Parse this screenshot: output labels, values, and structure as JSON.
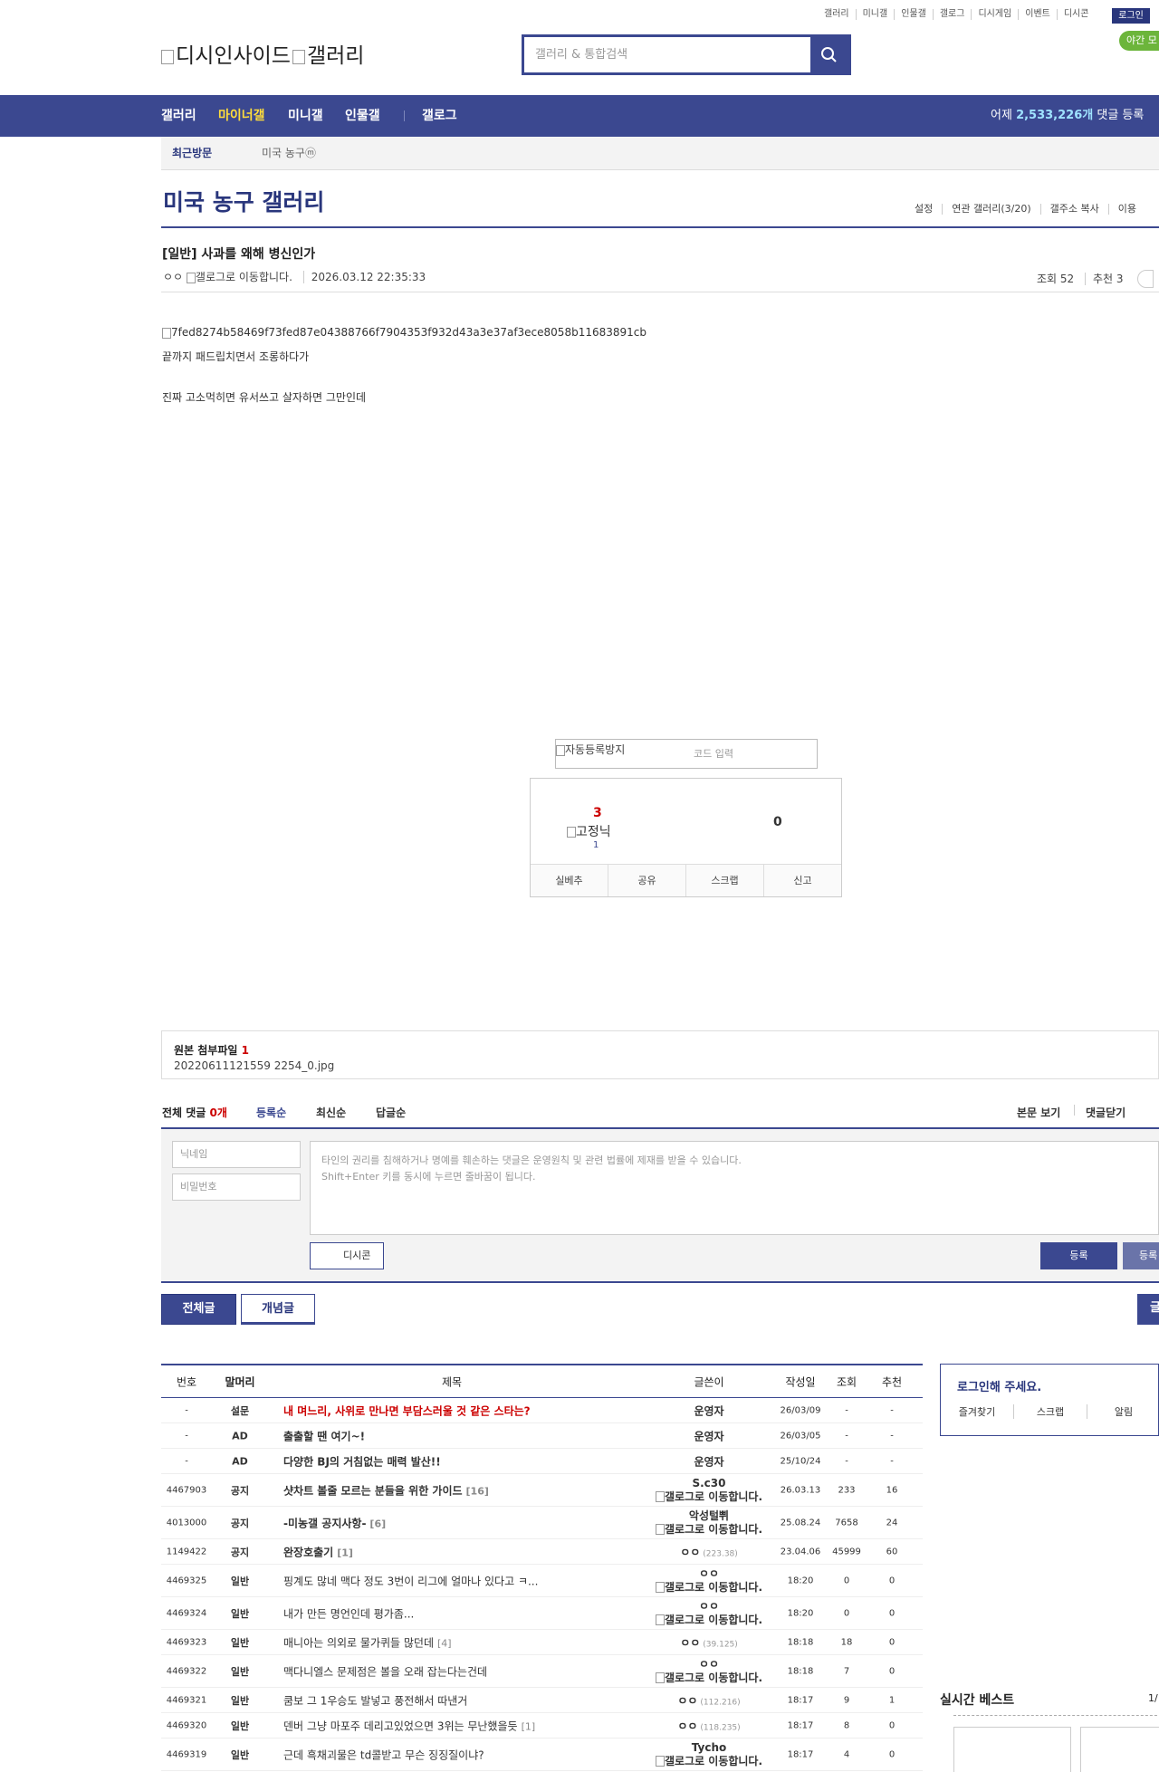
{
  "util_links": [
    "갤러리",
    "미니갤",
    "인물갤",
    "갤로그",
    "디시게임",
    "이벤트",
    "디시콘"
  ],
  "login_label": "로그인",
  "night_label": "야간 모",
  "logo_alt": "디시인사이드",
  "logo_alt2": "갤러리",
  "search_placeholder": "갤러리 & 통합검색",
  "nav": {
    "items": [
      "갤러리",
      "마이너갤",
      "미니갤",
      "인물갤",
      "갤로그"
    ],
    "yesterday_prefix": "어제",
    "yesterday_count": "2,533,226개",
    "yesterday_suffix": "댓글 등록"
  },
  "recent": {
    "label": "최근방문",
    "gallery": "미국 농구ⓜ"
  },
  "gallery_title": "미국 농구 갤러리",
  "gallery_opts": [
    "설정",
    "연관 갤러리(3/20)",
    "갤주소 복사",
    "이용"
  ],
  "post": {
    "title": "[일반] 사과를 왜해 병신인가",
    "author": "ㅇㅇ",
    "author_img_alt": "갤로그로 이동합니다.",
    "date": "2026.03.12 22:35:33",
    "views": "조회 52",
    "recommend": "추천 3",
    "image_alt": "7fed8274b58469f73fed87e04388766f7904353f932d43a3e37af3ece8058b11683891cb",
    "body_lines": [
      "끝까지 패드립치면서 조롱하다가",
      "진짜 고소먹히면 유서쓰고 살자하면 그만인데"
    ]
  },
  "captcha": {
    "img_alt": "자동등록방지",
    "placeholder": "코드 입력"
  },
  "vote": {
    "up": "3",
    "fix_alt": "고정닉",
    "fix_count": "1",
    "down": "0",
    "buttons": [
      "실베추",
      "공유",
      "스크랩",
      "신고"
    ]
  },
  "attach": {
    "label": "원본 첨부파일",
    "count": "1",
    "file": "20220611121559 2254_0.jpg"
  },
  "comments": {
    "all_label": "전체 댓글",
    "all_count": "0개",
    "sort": [
      "등록순",
      "최신순",
      "답글순"
    ],
    "right": [
      "본문 보기",
      "댓글닫기"
    ]
  },
  "comment_form": {
    "nick_ph": "닉네임",
    "pw_ph": "비밀번호",
    "ta_line1": "타인의 권리를 침해하거나 명예를 훼손하는 댓글은 운영원칙 및 관련 법률에 제재를 받을 수 있습니다.",
    "ta_line2": "Shift+Enter 키를 동시에 누르면 줄바꿈이 됩니다.",
    "dcon": "디시콘",
    "submit": "등록",
    "submit2": "등록"
  },
  "tabs": {
    "all": "전체글",
    "concept": "개념글",
    "write": "글"
  },
  "list_headers": [
    "번호",
    "말머리",
    "제목",
    "글쓴이",
    "작성일",
    "조회",
    "추천"
  ],
  "rows": [
    {
      "no": "-",
      "head": "설문",
      "title": "내 며느리, 사위로 만나면 부담스러울 것 같은 스타는?",
      "style": "red",
      "cnt": "",
      "writer": "운영자",
      "wline2": "",
      "ip": "",
      "date": "26/03/09",
      "views": "-",
      "rec": "-"
    },
    {
      "no": "-",
      "head": "AD",
      "title": "출출할 땐 여기~!",
      "style": "b",
      "cnt": "",
      "writer": "운영자",
      "wline2": "",
      "ip": "",
      "date": "26/03/05",
      "views": "-",
      "rec": "-"
    },
    {
      "no": "-",
      "head": "AD",
      "title": "다양한 BJ의 거침없는 매력 발산!!",
      "style": "b",
      "cnt": "",
      "writer": "운영자",
      "wline2": "",
      "ip": "",
      "date": "25/10/24",
      "views": "-",
      "rec": "-"
    },
    {
      "no": "4467903",
      "head": "공지",
      "title": "샷차트 볼줄 모르는 분들을 위한 가이드",
      "style": "b",
      "cnt": "[16]",
      "writer": "S.c30",
      "wline2": "갤로그로 이동합니다.",
      "ip": "",
      "date": "26.03.13",
      "views": "233",
      "rec": "16"
    },
    {
      "no": "4013000",
      "head": "공지",
      "title": "-미농갤 공지사항-",
      "style": "b",
      "cnt": "[6]",
      "writer": "악성털쀠",
      "wline2": "갤로그로 이동합니다.",
      "ip": "",
      "date": "25.08.24",
      "views": "7658",
      "rec": "24"
    },
    {
      "no": "1149422",
      "head": "공지",
      "title": "완장호출기",
      "style": "b",
      "cnt": "[1]",
      "writer": "ㅇㅇ",
      "wline2": "",
      "ip": "(223.38)",
      "date": "23.04.06",
      "views": "45999",
      "rec": "60"
    },
    {
      "no": "4469325",
      "head": "일반",
      "title": "핑계도 많네 맥다 정도 3번이 리그에 얼마나 있다고 ㅋ...",
      "style": "",
      "cnt": "",
      "writer": "ㅇㅇ",
      "wline2": "갤로그로 이동합니다.",
      "ip": "",
      "date": "18:20",
      "views": "0",
      "rec": "0"
    },
    {
      "no": "4469324",
      "head": "일반",
      "title": "내가 만든 명언인데 평가좀...",
      "style": "",
      "cnt": "",
      "writer": "ㅇㅇ",
      "wline2": "갤로그로 이동합니다.",
      "ip": "",
      "date": "18:20",
      "views": "0",
      "rec": "0"
    },
    {
      "no": "4469323",
      "head": "일반",
      "title": "매니아는 의외로 물가퀴들 많던데",
      "style": "",
      "cnt": "[4]",
      "writer": "ㅇㅇ",
      "wline2": "",
      "ip": "(39.125)",
      "date": "18:18",
      "views": "18",
      "rec": "0"
    },
    {
      "no": "4469322",
      "head": "일반",
      "title": "맥다니엘스 문제점은 볼을 오래 잡는다는건데",
      "style": "",
      "cnt": "",
      "writer": "ㅇㅇ",
      "wline2": "갤로그로 이동합니다.",
      "ip": "",
      "date": "18:18",
      "views": "7",
      "rec": "0"
    },
    {
      "no": "4469321",
      "head": "일반",
      "title": "쿰보 그 1우승도 발넣고 풍전해서 따낸거",
      "style": "",
      "cnt": "",
      "writer": "ㅇㅇ",
      "wline2": "",
      "ip": "(112.216)",
      "date": "18:17",
      "views": "9",
      "rec": "1"
    },
    {
      "no": "4469320",
      "head": "일반",
      "title": "덴버 그냥 마포주 데리고있었으면 3위는 무난했을듯",
      "style": "",
      "cnt": "[1]",
      "writer": "ㅇㅇ",
      "wline2": "",
      "ip": "(118.235)",
      "date": "18:17",
      "views": "8",
      "rec": "0"
    },
    {
      "no": "4469319",
      "head": "일반",
      "title": "근데 흑채괴물은 td콜받고 무슨 징징질이냐?",
      "style": "",
      "cnt": "",
      "writer": "Tycho",
      "wline2": "갤로그로 이동합니다.",
      "ip": "",
      "date": "18:17",
      "views": "4",
      "rec": "0"
    }
  ],
  "side": {
    "login_prompt": "로그인해 주세요.",
    "links": [
      "즐겨찾기",
      "스크랩",
      "알림"
    ],
    "best_title": "실시간 베스트",
    "best_page": "1/"
  }
}
